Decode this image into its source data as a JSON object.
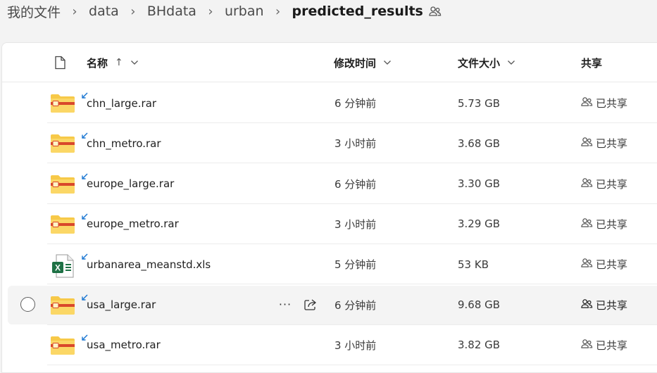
{
  "breadcrumb": {
    "items": [
      "我的文件",
      "data",
      "BHdata",
      "urban",
      "predicted_results"
    ],
    "separator": "›"
  },
  "columns": {
    "name": "名称",
    "name_sort": "↑",
    "modified": "修改时间",
    "size": "文件大小",
    "sharing": "共享"
  },
  "files": [
    {
      "name": "chn_large.rar",
      "modified": "6 分钟前",
      "size": "5.73 GB",
      "sharing": "已共享",
      "type": "archive"
    },
    {
      "name": "chn_metro.rar",
      "modified": "3 小时前",
      "size": "3.68 GB",
      "sharing": "已共享",
      "type": "archive"
    },
    {
      "name": "europe_large.rar",
      "modified": "6 分钟前",
      "size": "3.30 GB",
      "sharing": "已共享",
      "type": "archive"
    },
    {
      "name": "europe_metro.rar",
      "modified": "3 小时前",
      "size": "3.29 GB",
      "sharing": "已共享",
      "type": "archive"
    },
    {
      "name": "urbanarea_meanstd.xls",
      "modified": "5 分钟前",
      "size": "53 KB",
      "sharing": "已共享",
      "type": "excel"
    },
    {
      "name": "usa_large.rar",
      "modified": "6 分钟前",
      "size": "9.68 GB",
      "sharing": "已共享",
      "type": "archive"
    },
    {
      "name": "usa_metro.rar",
      "modified": "3 小时前",
      "size": "3.82 GB",
      "sharing": "已共享",
      "type": "archive"
    }
  ],
  "hovered_row": 5,
  "row_actions": {
    "more": "···"
  },
  "colors": {
    "folder_yellow": "#f7c948",
    "archive_band": "#d9482b",
    "excel_green": "#1e7145",
    "sync_badge": "#1976d2"
  }
}
